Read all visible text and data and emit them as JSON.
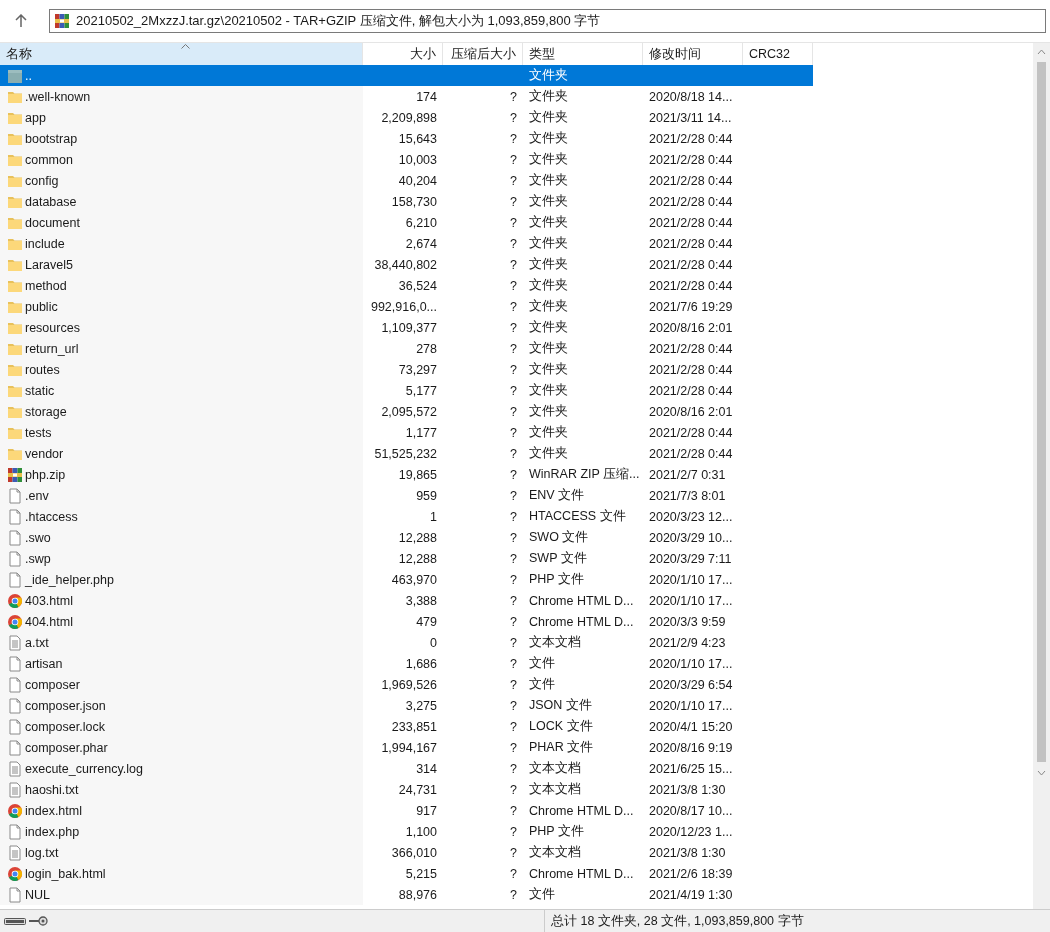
{
  "address_bar": {
    "path": "20210502_2MxzzJ.tar.gz\\20210502 - TAR+GZIP 压缩文件, 解包大小为 1,093,859,800 字节"
  },
  "columns": [
    {
      "label": "名称",
      "sorted": true
    },
    {
      "label": "大小",
      "sorted": false
    },
    {
      "label": "压缩后大小",
      "sorted": false
    },
    {
      "label": "类型",
      "sorted": false
    },
    {
      "label": "修改时间",
      "sorted": false
    },
    {
      "label": "CRC32",
      "sorted": false
    }
  ],
  "rows": [
    {
      "kind": "parent",
      "name": "..",
      "type": "文件夹",
      "selected": true
    },
    {
      "kind": "folder",
      "name": ".well-known",
      "size": "174",
      "packed": "?",
      "type": "文件夹",
      "modified": "2020/8/18 14...",
      "selected": false
    },
    {
      "kind": "folder",
      "name": "app",
      "size": "2,209,898",
      "packed": "?",
      "type": "文件夹",
      "modified": "2021/3/11 14...",
      "selected": false
    },
    {
      "kind": "folder",
      "name": "bootstrap",
      "size": "15,643",
      "packed": "?",
      "type": "文件夹",
      "modified": "2021/2/28 0:44",
      "selected": false
    },
    {
      "kind": "folder",
      "name": "common",
      "size": "10,003",
      "packed": "?",
      "type": "文件夹",
      "modified": "2021/2/28 0:44",
      "selected": false
    },
    {
      "kind": "folder",
      "name": "config",
      "size": "40,204",
      "packed": "?",
      "type": "文件夹",
      "modified": "2021/2/28 0:44",
      "selected": false
    },
    {
      "kind": "folder",
      "name": "database",
      "size": "158,730",
      "packed": "?",
      "type": "文件夹",
      "modified": "2021/2/28 0:44",
      "selected": false
    },
    {
      "kind": "folder",
      "name": "document",
      "size": "6,210",
      "packed": "?",
      "type": "文件夹",
      "modified": "2021/2/28 0:44",
      "selected": false
    },
    {
      "kind": "folder",
      "name": "include",
      "size": "2,674",
      "packed": "?",
      "type": "文件夹",
      "modified": "2021/2/28 0:44",
      "selected": false
    },
    {
      "kind": "folder",
      "name": "Laravel5",
      "size": "38,440,802",
      "packed": "?",
      "type": "文件夹",
      "modified": "2021/2/28 0:44",
      "selected": false
    },
    {
      "kind": "folder",
      "name": "method",
      "size": "36,524",
      "packed": "?",
      "type": "文件夹",
      "modified": "2021/2/28 0:44",
      "selected": false
    },
    {
      "kind": "folder",
      "name": "public",
      "size": "992,916,0...",
      "packed": "?",
      "type": "文件夹",
      "modified": "2021/7/6 19:29",
      "selected": false
    },
    {
      "kind": "folder",
      "name": "resources",
      "size": "1,109,377",
      "packed": "?",
      "type": "文件夹",
      "modified": "2020/8/16 2:01",
      "selected": false
    },
    {
      "kind": "folder",
      "name": "return_url",
      "size": "278",
      "packed": "?",
      "type": "文件夹",
      "modified": "2021/2/28 0:44",
      "selected": false
    },
    {
      "kind": "folder",
      "name": "routes",
      "size": "73,297",
      "packed": "?",
      "type": "文件夹",
      "modified": "2021/2/28 0:44",
      "selected": false
    },
    {
      "kind": "folder",
      "name": "static",
      "size": "5,177",
      "packed": "?",
      "type": "文件夹",
      "modified": "2021/2/28 0:44",
      "selected": false
    },
    {
      "kind": "folder",
      "name": "storage",
      "size": "2,095,572",
      "packed": "?",
      "type": "文件夹",
      "modified": "2020/8/16 2:01",
      "selected": false
    },
    {
      "kind": "folder",
      "name": "tests",
      "size": "1,177",
      "packed": "?",
      "type": "文件夹",
      "modified": "2021/2/28 0:44",
      "selected": false
    },
    {
      "kind": "folder",
      "name": "vendor",
      "size": "51,525,232",
      "packed": "?",
      "type": "文件夹",
      "modified": "2021/2/28 0:44",
      "selected": false
    },
    {
      "kind": "archive",
      "name": "php.zip",
      "size": "19,865",
      "packed": "?",
      "type": "WinRAR ZIP 压缩...",
      "modified": "2021/2/7 0:31",
      "selected": false
    },
    {
      "kind": "file",
      "name": ".env",
      "size": "959",
      "packed": "?",
      "type": "ENV 文件",
      "modified": "2021/7/3 8:01",
      "selected": false
    },
    {
      "kind": "file",
      "name": ".htaccess",
      "size": "1",
      "packed": "?",
      "type": "HTACCESS 文件",
      "modified": "2020/3/23 12...",
      "selected": false
    },
    {
      "kind": "file",
      "name": ".swo",
      "size": "12,288",
      "packed": "?",
      "type": "SWO 文件",
      "modified": "2020/3/29 10...",
      "selected": false
    },
    {
      "kind": "file",
      "name": ".swp",
      "size": "12,288",
      "packed": "?",
      "type": "SWP 文件",
      "modified": "2020/3/29 7:11",
      "selected": false
    },
    {
      "kind": "file",
      "name": "_ide_helper.php",
      "size": "463,970",
      "packed": "?",
      "type": "PHP 文件",
      "modified": "2020/1/10 17...",
      "selected": false
    },
    {
      "kind": "browser",
      "name": "403.html",
      "size": "3,388",
      "packed": "?",
      "type": "Chrome HTML D...",
      "modified": "2020/1/10 17...",
      "selected": false
    },
    {
      "kind": "browser",
      "name": "404.html",
      "size": "479",
      "packed": "?",
      "type": "Chrome HTML D...",
      "modified": "2020/3/3 9:59",
      "selected": false
    },
    {
      "kind": "text",
      "name": "a.txt",
      "size": "0",
      "packed": "?",
      "type": "文本文档",
      "modified": "2021/2/9 4:23",
      "selected": false
    },
    {
      "kind": "file",
      "name": "artisan",
      "size": "1,686",
      "packed": "?",
      "type": "文件",
      "modified": "2020/1/10 17...",
      "selected": false
    },
    {
      "kind": "file",
      "name": "composer",
      "size": "1,969,526",
      "packed": "?",
      "type": "文件",
      "modified": "2020/3/29 6:54",
      "selected": false
    },
    {
      "kind": "file",
      "name": "composer.json",
      "size": "3,275",
      "packed": "?",
      "type": "JSON 文件",
      "modified": "2020/1/10 17...",
      "selected": false
    },
    {
      "kind": "file",
      "name": "composer.lock",
      "size": "233,851",
      "packed": "?",
      "type": "LOCK 文件",
      "modified": "2020/4/1 15:20",
      "selected": false
    },
    {
      "kind": "file",
      "name": "composer.phar",
      "size": "1,994,167",
      "packed": "?",
      "type": "PHAR 文件",
      "modified": "2020/8/16 9:19",
      "selected": false
    },
    {
      "kind": "text",
      "name": "execute_currency.log",
      "size": "314",
      "packed": "?",
      "type": "文本文档",
      "modified": "2021/6/25 15...",
      "selected": false
    },
    {
      "kind": "text",
      "name": "haoshi.txt",
      "size": "24,731",
      "packed": "?",
      "type": "文本文档",
      "modified": "2021/3/8 1:30",
      "selected": false
    },
    {
      "kind": "browser",
      "name": "index.html",
      "size": "917",
      "packed": "?",
      "type": "Chrome HTML D...",
      "modified": "2020/8/17 10...",
      "selected": false
    },
    {
      "kind": "file",
      "name": "index.php",
      "size": "1,100",
      "packed": "?",
      "type": "PHP 文件",
      "modified": "2020/12/23 1...",
      "selected": false
    },
    {
      "kind": "text",
      "name": "log.txt",
      "size": "366,010",
      "packed": "?",
      "type": "文本文档",
      "modified": "2021/3/8 1:30",
      "selected": false
    },
    {
      "kind": "browser",
      "name": "login_bak.html",
      "size": "5,215",
      "packed": "?",
      "type": "Chrome HTML D...",
      "modified": "2021/2/6 18:39",
      "selected": false
    },
    {
      "kind": "file",
      "name": "NUL",
      "size": "88,976",
      "packed": "?",
      "type": "文件",
      "modified": "2021/4/19 1:30",
      "selected": false
    }
  ],
  "status_bar": {
    "summary": "总计 18 文件夹, 28 文件, 1,093,859,800 字节"
  }
}
